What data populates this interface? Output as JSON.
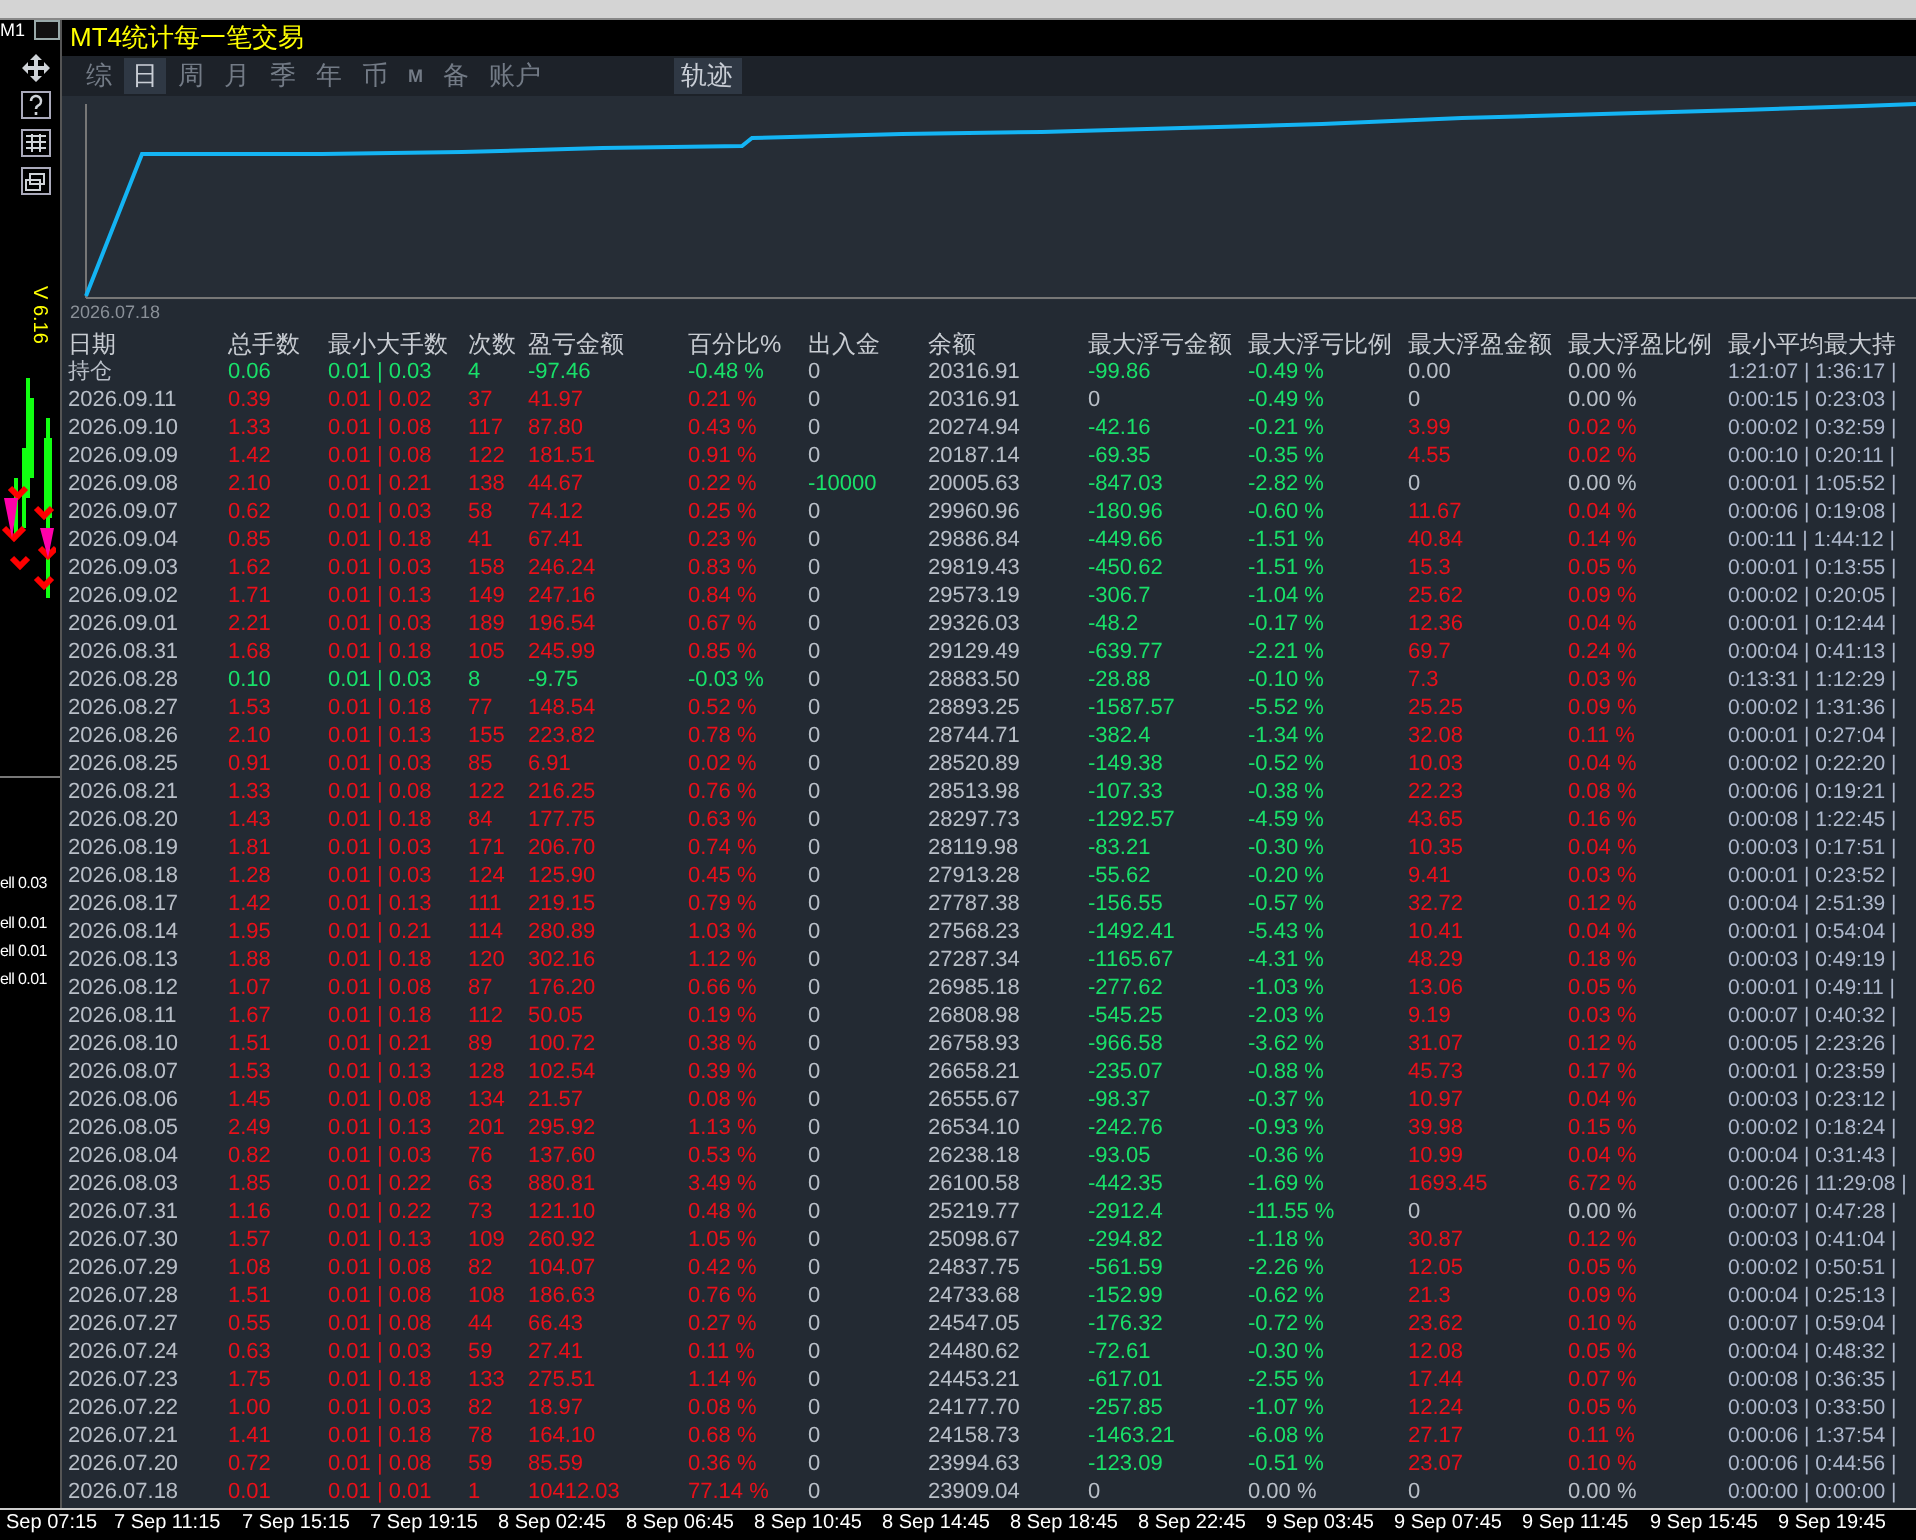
{
  "chart_window": {
    "timeframe": "M1",
    "version": "V 6.16",
    "order_labels": [
      "ell 0.03",
      "ell 0.01",
      "ell 0.01",
      "ell 0.01"
    ],
    "time_axis": [
      "Sep 07:15",
      "7 Sep 11:15",
      "7 Sep 15:15",
      "7 Sep 19:15",
      "8 Sep 02:45",
      "8 Sep 06:45",
      "8 Sep 10:45",
      "8 Sep 14:45",
      "8 Sep 18:45",
      "8 Sep 22:45",
      "9 Sep 03:45",
      "9 Sep 07:45",
      "9 Sep 11:45",
      "9 Sep 15:45",
      "9 Sep 19:45"
    ]
  },
  "panel": {
    "title": "MT4统计每一笔交易",
    "tabs": [
      {
        "label": "综",
        "selected": false,
        "small": false
      },
      {
        "label": "日",
        "selected": true,
        "small": false
      },
      {
        "label": "周",
        "selected": false,
        "small": false
      },
      {
        "label": "月",
        "selected": false,
        "small": false
      },
      {
        "label": "季",
        "selected": false,
        "small": false
      },
      {
        "label": "年",
        "selected": false,
        "small": false
      },
      {
        "label": "币",
        "selected": false,
        "small": false
      },
      {
        "label": "M",
        "selected": false,
        "small": true
      },
      {
        "label": "备",
        "selected": false,
        "small": false
      },
      {
        "label": "账户",
        "selected": false,
        "small": false
      }
    ],
    "view_tabs": [
      {
        "label": "轨迹",
        "selected": true
      }
    ],
    "equity_chart": {
      "start_label": "2026.07.18"
    },
    "table": {
      "columns": [
        "日期",
        "总手数",
        "最小大手数",
        "次数",
        "盈亏金额",
        "百分比%",
        "出入金",
        "余额",
        "最大浮亏金额",
        "最大浮亏比例",
        "最大浮盈金额",
        "最大浮盈比例",
        "最小平均最大持"
      ],
      "rows": [
        {
          "loss": true,
          "flow_out": false,
          "loss_amount_flat": false,
          "loss_pct_flat": false,
          "gain_flat": true,
          "cells": [
            "持仓",
            "0.06",
            "0.01 | 0.03",
            "4",
            "-97.46",
            "-0.48 %",
            "0",
            "20316.91",
            "-99.86",
            "-0.49 %",
            "0.00",
            "0.00 %",
            "1:21:07 | 1:36:17 |"
          ]
        },
        {
          "loss": false,
          "flow_out": false,
          "loss_amount_flat": true,
          "loss_pct_flat": false,
          "gain_flat": true,
          "cells": [
            "2026.09.11",
            "0.39",
            "0.01 | 0.02",
            "37",
            "41.97",
            "0.21 %",
            "0",
            "20316.91",
            "0",
            "-0.49 %",
            "0",
            "0.00 %",
            "0:00:15 | 0:23:03 |"
          ]
        },
        {
          "loss": false,
          "flow_out": false,
          "loss_amount_flat": false,
          "loss_pct_flat": false,
          "gain_flat": false,
          "cells": [
            "2026.09.10",
            "1.33",
            "0.01 | 0.08",
            "117",
            "87.80",
            "0.43 %",
            "0",
            "20274.94",
            "-42.16",
            "-0.21 %",
            "3.99",
            "0.02 %",
            "0:00:02 | 0:32:59 |"
          ]
        },
        {
          "loss": false,
          "flow_out": false,
          "loss_amount_flat": false,
          "loss_pct_flat": false,
          "gain_flat": false,
          "cells": [
            "2026.09.09",
            "1.42",
            "0.01 | 0.08",
            "122",
            "181.51",
            "0.91 %",
            "0",
            "20187.14",
            "-69.35",
            "-0.35 %",
            "4.55",
            "0.02 %",
            "0:00:10 | 0:20:11 |"
          ]
        },
        {
          "loss": false,
          "flow_out": true,
          "loss_amount_flat": false,
          "loss_pct_flat": false,
          "gain_flat": true,
          "cells": [
            "2026.09.08",
            "2.10",
            "0.01 | 0.21",
            "138",
            "44.67",
            "0.22 %",
            "-10000",
            "20005.63",
            "-847.03",
            "-2.82 %",
            "0",
            "0.00 %",
            "0:00:01 | 1:05:52 |"
          ]
        },
        {
          "loss": false,
          "flow_out": false,
          "loss_amount_flat": false,
          "loss_pct_flat": false,
          "gain_flat": false,
          "cells": [
            "2026.09.07",
            "0.62",
            "0.01 | 0.03",
            "58",
            "74.12",
            "0.25 %",
            "0",
            "29960.96",
            "-180.96",
            "-0.60 %",
            "11.67",
            "0.04 %",
            "0:00:06 | 0:19:08 |"
          ]
        },
        {
          "loss": false,
          "flow_out": false,
          "loss_amount_flat": false,
          "loss_pct_flat": false,
          "gain_flat": false,
          "cells": [
            "2026.09.04",
            "0.85",
            "0.01 | 0.18",
            "41",
            "67.41",
            "0.23 %",
            "0",
            "29886.84",
            "-449.66",
            "-1.51 %",
            "40.84",
            "0.14 %",
            "0:00:11 | 1:44:12 |"
          ]
        },
        {
          "loss": false,
          "flow_out": false,
          "loss_amount_flat": false,
          "loss_pct_flat": false,
          "gain_flat": false,
          "cells": [
            "2026.09.03",
            "1.62",
            "0.01 | 0.03",
            "158",
            "246.24",
            "0.83 %",
            "0",
            "29819.43",
            "-450.62",
            "-1.51 %",
            "15.3",
            "0.05 %",
            "0:00:01 | 0:13:55 |"
          ]
        },
        {
          "loss": false,
          "flow_out": false,
          "loss_amount_flat": false,
          "loss_pct_flat": false,
          "gain_flat": false,
          "cells": [
            "2026.09.02",
            "1.71",
            "0.01 | 0.13",
            "149",
            "247.16",
            "0.84 %",
            "0",
            "29573.19",
            "-306.7",
            "-1.04 %",
            "25.62",
            "0.09 %",
            "0:00:02 | 0:20:05 |"
          ]
        },
        {
          "loss": false,
          "flow_out": false,
          "loss_amount_flat": false,
          "loss_pct_flat": false,
          "gain_flat": false,
          "cells": [
            "2026.09.01",
            "2.21",
            "0.01 | 0.03",
            "189",
            "196.54",
            "0.67 %",
            "0",
            "29326.03",
            "-48.2",
            "-0.17 %",
            "12.36",
            "0.04 %",
            "0:00:01 | 0:12:44 |"
          ]
        },
        {
          "loss": false,
          "flow_out": false,
          "loss_amount_flat": false,
          "loss_pct_flat": false,
          "gain_flat": false,
          "cells": [
            "2026.08.31",
            "1.68",
            "0.01 | 0.18",
            "105",
            "245.99",
            "0.85 %",
            "0",
            "29129.49",
            "-639.77",
            "-2.21 %",
            "69.7",
            "0.24 %",
            "0:00:04 | 0:41:13 |"
          ]
        },
        {
          "loss": true,
          "flow_out": false,
          "loss_amount_flat": false,
          "loss_pct_flat": false,
          "gain_flat": false,
          "cells": [
            "2026.08.28",
            "0.10",
            "0.01 | 0.03",
            "8",
            "-9.75",
            "-0.03 %",
            "0",
            "28883.50",
            "-28.88",
            "-0.10 %",
            "7.3",
            "0.03 %",
            "0:13:31 | 1:12:29 |"
          ]
        },
        {
          "loss": false,
          "flow_out": false,
          "loss_amount_flat": false,
          "loss_pct_flat": false,
          "gain_flat": false,
          "cells": [
            "2026.08.27",
            "1.53",
            "0.01 | 0.18",
            "77",
            "148.54",
            "0.52 %",
            "0",
            "28893.25",
            "-1587.57",
            "-5.52 %",
            "25.25",
            "0.09 %",
            "0:00:02 | 1:31:36 |"
          ]
        },
        {
          "loss": false,
          "flow_out": false,
          "loss_amount_flat": false,
          "loss_pct_flat": false,
          "gain_flat": false,
          "cells": [
            "2026.08.26",
            "2.10",
            "0.01 | 0.13",
            "155",
            "223.82",
            "0.78 %",
            "0",
            "28744.71",
            "-382.4",
            "-1.34 %",
            "32.08",
            "0.11 %",
            "0:00:01 | 0:27:04 |"
          ]
        },
        {
          "loss": false,
          "flow_out": false,
          "loss_amount_flat": false,
          "loss_pct_flat": false,
          "gain_flat": false,
          "cells": [
            "2026.08.25",
            "0.91",
            "0.01 | 0.03",
            "85",
            "6.91",
            "0.02 %",
            "0",
            "28520.89",
            "-149.38",
            "-0.52 %",
            "10.03",
            "0.04 %",
            "0:00:02 | 0:22:20 |"
          ]
        },
        {
          "loss": false,
          "flow_out": false,
          "loss_amount_flat": false,
          "loss_pct_flat": false,
          "gain_flat": false,
          "cells": [
            "2026.08.21",
            "1.33",
            "0.01 | 0.08",
            "122",
            "216.25",
            "0.76 %",
            "0",
            "28513.98",
            "-107.33",
            "-0.38 %",
            "22.23",
            "0.08 %",
            "0:00:06 | 0:19:21 |"
          ]
        },
        {
          "loss": false,
          "flow_out": false,
          "loss_amount_flat": false,
          "loss_pct_flat": false,
          "gain_flat": false,
          "cells": [
            "2026.08.20",
            "1.43",
            "0.01 | 0.18",
            "84",
            "177.75",
            "0.63 %",
            "0",
            "28297.73",
            "-1292.57",
            "-4.59 %",
            "43.65",
            "0.16 %",
            "0:00:08 | 1:22:45 |"
          ]
        },
        {
          "loss": false,
          "flow_out": false,
          "loss_amount_flat": false,
          "loss_pct_flat": false,
          "gain_flat": false,
          "cells": [
            "2026.08.19",
            "1.81",
            "0.01 | 0.03",
            "171",
            "206.70",
            "0.74 %",
            "0",
            "28119.98",
            "-83.21",
            "-0.30 %",
            "10.35",
            "0.04 %",
            "0:00:03 | 0:17:51 |"
          ]
        },
        {
          "loss": false,
          "flow_out": false,
          "loss_amount_flat": false,
          "loss_pct_flat": false,
          "gain_flat": false,
          "cells": [
            "2026.08.18",
            "1.28",
            "0.01 | 0.03",
            "124",
            "125.90",
            "0.45 %",
            "0",
            "27913.28",
            "-55.62",
            "-0.20 %",
            "9.41",
            "0.03 %",
            "0:00:01 | 0:23:52 |"
          ]
        },
        {
          "loss": false,
          "flow_out": false,
          "loss_amount_flat": false,
          "loss_pct_flat": false,
          "gain_flat": false,
          "cells": [
            "2026.08.17",
            "1.42",
            "0.01 | 0.13",
            "111",
            "219.15",
            "0.79 %",
            "0",
            "27787.38",
            "-156.55",
            "-0.57 %",
            "32.72",
            "0.12 %",
            "0:00:04 | 2:51:39 |"
          ]
        },
        {
          "loss": false,
          "flow_out": false,
          "loss_amount_flat": false,
          "loss_pct_flat": false,
          "gain_flat": false,
          "cells": [
            "2026.08.14",
            "1.95",
            "0.01 | 0.21",
            "114",
            "280.89",
            "1.03 %",
            "0",
            "27568.23",
            "-1492.41",
            "-5.43 %",
            "10.41",
            "0.04 %",
            "0:00:01 | 0:54:04 |"
          ]
        },
        {
          "loss": false,
          "flow_out": false,
          "loss_amount_flat": false,
          "loss_pct_flat": false,
          "gain_flat": false,
          "cells": [
            "2026.08.13",
            "1.88",
            "0.01 | 0.18",
            "120",
            "302.16",
            "1.12 %",
            "0",
            "27287.34",
            "-1165.67",
            "-4.31 %",
            "48.29",
            "0.18 %",
            "0:00:03 | 0:49:19 |"
          ]
        },
        {
          "loss": false,
          "flow_out": false,
          "loss_amount_flat": false,
          "loss_pct_flat": false,
          "gain_flat": false,
          "cells": [
            "2026.08.12",
            "1.07",
            "0.01 | 0.08",
            "87",
            "176.20",
            "0.66 %",
            "0",
            "26985.18",
            "-277.62",
            "-1.03 %",
            "13.06",
            "0.05 %",
            "0:00:01 | 0:49:11 |"
          ]
        },
        {
          "loss": false,
          "flow_out": false,
          "loss_amount_flat": false,
          "loss_pct_flat": false,
          "gain_flat": false,
          "cells": [
            "2026.08.11",
            "1.67",
            "0.01 | 0.18",
            "112",
            "50.05",
            "0.19 %",
            "0",
            "26808.98",
            "-545.25",
            "-2.03 %",
            "9.19",
            "0.03 %",
            "0:00:07 | 0:40:32 |"
          ]
        },
        {
          "loss": false,
          "flow_out": false,
          "loss_amount_flat": false,
          "loss_pct_flat": false,
          "gain_flat": false,
          "cells": [
            "2026.08.10",
            "1.51",
            "0.01 | 0.21",
            "89",
            "100.72",
            "0.38 %",
            "0",
            "26758.93",
            "-966.58",
            "-3.62 %",
            "31.07",
            "0.12 %",
            "0:00:05 | 2:23:26 |"
          ]
        },
        {
          "loss": false,
          "flow_out": false,
          "loss_amount_flat": false,
          "loss_pct_flat": false,
          "gain_flat": false,
          "cells": [
            "2026.08.07",
            "1.53",
            "0.01 | 0.13",
            "128",
            "102.54",
            "0.39 %",
            "0",
            "26658.21",
            "-235.07",
            "-0.88 %",
            "45.73",
            "0.17 %",
            "0:00:01 | 0:23:59 |"
          ]
        },
        {
          "loss": false,
          "flow_out": false,
          "loss_amount_flat": false,
          "loss_pct_flat": false,
          "gain_flat": false,
          "cells": [
            "2026.08.06",
            "1.45",
            "0.01 | 0.08",
            "134",
            "21.57",
            "0.08 %",
            "0",
            "26555.67",
            "-98.37",
            "-0.37 %",
            "10.97",
            "0.04 %",
            "0:00:03 | 0:23:12 |"
          ]
        },
        {
          "loss": false,
          "flow_out": false,
          "loss_amount_flat": false,
          "loss_pct_flat": false,
          "gain_flat": false,
          "cells": [
            "2026.08.05",
            "2.49",
            "0.01 | 0.13",
            "201",
            "295.92",
            "1.13 %",
            "0",
            "26534.10",
            "-242.76",
            "-0.93 %",
            "39.98",
            "0.15 %",
            "0:00:02 | 0:18:24 |"
          ]
        },
        {
          "loss": false,
          "flow_out": false,
          "loss_amount_flat": false,
          "loss_pct_flat": false,
          "gain_flat": false,
          "cells": [
            "2026.08.04",
            "0.82",
            "0.01 | 0.03",
            "76",
            "137.60",
            "0.53 %",
            "0",
            "26238.18",
            "-93.05",
            "-0.36 %",
            "10.99",
            "0.04 %",
            "0:00:04 | 0:31:43 |"
          ]
        },
        {
          "loss": false,
          "flow_out": false,
          "loss_amount_flat": false,
          "loss_pct_flat": false,
          "gain_flat": false,
          "cells": [
            "2026.08.03",
            "1.85",
            "0.01 | 0.22",
            "63",
            "880.81",
            "3.49 %",
            "0",
            "26100.58",
            "-442.35",
            "-1.69 %",
            "1693.45",
            "6.72 %",
            "0:00:26 | 11:29:08 |"
          ]
        },
        {
          "loss": false,
          "flow_out": false,
          "loss_amount_flat": false,
          "loss_pct_flat": false,
          "gain_flat": true,
          "cells": [
            "2026.07.31",
            "1.16",
            "0.01 | 0.22",
            "73",
            "121.10",
            "0.48 %",
            "0",
            "25219.77",
            "-2912.4",
            "-11.55 %",
            "0",
            "0.00 %",
            "0:00:07 | 0:47:28 |"
          ]
        },
        {
          "loss": false,
          "flow_out": false,
          "loss_amount_flat": false,
          "loss_pct_flat": false,
          "gain_flat": false,
          "cells": [
            "2026.07.30",
            "1.57",
            "0.01 | 0.13",
            "109",
            "260.92",
            "1.05 %",
            "0",
            "25098.67",
            "-294.82",
            "-1.18 %",
            "30.87",
            "0.12 %",
            "0:00:03 | 0:41:04 |"
          ]
        },
        {
          "loss": false,
          "flow_out": false,
          "loss_amount_flat": false,
          "loss_pct_flat": false,
          "gain_flat": false,
          "cells": [
            "2026.07.29",
            "1.08",
            "0.01 | 0.08",
            "82",
            "104.07",
            "0.42 %",
            "0",
            "24837.75",
            "-561.59",
            "-2.26 %",
            "12.05",
            "0.05 %",
            "0:00:02 | 0:50:51 |"
          ]
        },
        {
          "loss": false,
          "flow_out": false,
          "loss_amount_flat": false,
          "loss_pct_flat": false,
          "gain_flat": false,
          "cells": [
            "2026.07.28",
            "1.51",
            "0.01 | 0.08",
            "108",
            "186.63",
            "0.76 %",
            "0",
            "24733.68",
            "-152.99",
            "-0.62 %",
            "21.3",
            "0.09 %",
            "0:00:04 | 0:25:13 |"
          ]
        },
        {
          "loss": false,
          "flow_out": false,
          "loss_amount_flat": false,
          "loss_pct_flat": false,
          "gain_flat": false,
          "cells": [
            "2026.07.27",
            "0.55",
            "0.01 | 0.08",
            "44",
            "66.43",
            "0.27 %",
            "0",
            "24547.05",
            "-176.32",
            "-0.72 %",
            "23.62",
            "0.10 %",
            "0:00:07 | 0:59:04 |"
          ]
        },
        {
          "loss": false,
          "flow_out": false,
          "loss_amount_flat": false,
          "loss_pct_flat": false,
          "gain_flat": false,
          "cells": [
            "2026.07.24",
            "0.63",
            "0.01 | 0.03",
            "59",
            "27.41",
            "0.11 %",
            "0",
            "24480.62",
            "-72.61",
            "-0.30 %",
            "12.08",
            "0.05 %",
            "0:00:04 | 0:48:32 |"
          ]
        },
        {
          "loss": false,
          "flow_out": false,
          "loss_amount_flat": false,
          "loss_pct_flat": false,
          "gain_flat": false,
          "cells": [
            "2026.07.23",
            "1.75",
            "0.01 | 0.18",
            "133",
            "275.51",
            "1.14 %",
            "0",
            "24453.21",
            "-617.01",
            "-2.55 %",
            "17.44",
            "0.07 %",
            "0:00:08 | 0:36:35 |"
          ]
        },
        {
          "loss": false,
          "flow_out": false,
          "loss_amount_flat": false,
          "loss_pct_flat": false,
          "gain_flat": false,
          "cells": [
            "2026.07.22",
            "1.00",
            "0.01 | 0.03",
            "82",
            "18.97",
            "0.08 %",
            "0",
            "24177.70",
            "-257.85",
            "-1.07 %",
            "12.24",
            "0.05 %",
            "0:00:03 | 0:33:50 |"
          ]
        },
        {
          "loss": false,
          "flow_out": false,
          "loss_amount_flat": false,
          "loss_pct_flat": false,
          "gain_flat": false,
          "cells": [
            "2026.07.21",
            "1.41",
            "0.01 | 0.18",
            "78",
            "164.10",
            "0.68 %",
            "0",
            "24158.73",
            "-1463.21",
            "-6.08 %",
            "27.17",
            "0.11 %",
            "0:00:06 | 1:37:54 |"
          ]
        },
        {
          "loss": false,
          "flow_out": false,
          "loss_amount_flat": false,
          "loss_pct_flat": false,
          "gain_flat": false,
          "cells": [
            "2026.07.20",
            "0.72",
            "0.01 | 0.08",
            "59",
            "85.59",
            "0.36 %",
            "0",
            "23994.63",
            "-123.09",
            "-0.51 %",
            "23.07",
            "0.10 %",
            "0:00:06 | 0:44:56 |"
          ]
        },
        {
          "loss": false,
          "flow_out": false,
          "loss_amount_flat": true,
          "loss_pct_flat": true,
          "gain_flat": true,
          "cells": [
            "2026.07.18",
            "0.01",
            "0.01 | 0.01",
            "1",
            "10412.03",
            "77.14 %",
            "0",
            "23909.04",
            "0",
            "0.00 %",
            "0",
            "0.00 %",
            "0:00:00 | 0:00:00 |"
          ]
        }
      ]
    }
  }
}
